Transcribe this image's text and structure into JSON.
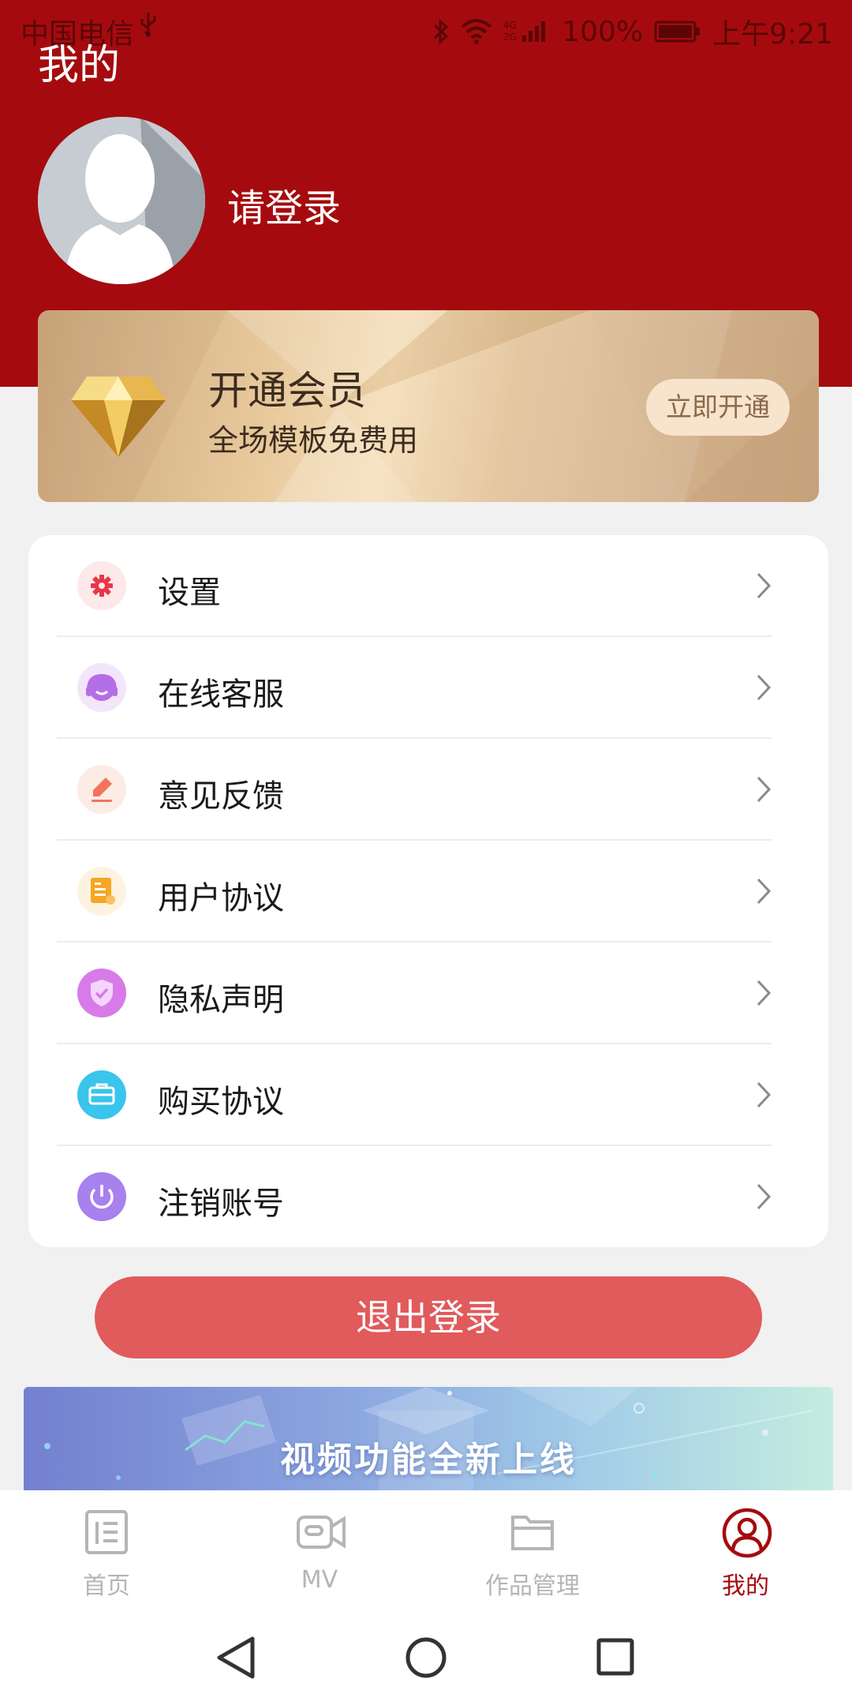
{
  "status_bar": {
    "carrier": "中国电信",
    "battery": "100%",
    "time": "上午9:21"
  },
  "header": {
    "title": "我的",
    "login_prompt": "请登录"
  },
  "vip": {
    "title": "开通会员",
    "subtitle": "全场模板免费用",
    "button": "立即开通"
  },
  "menu": [
    {
      "label": "设置",
      "icon": "gear-icon",
      "color": "#e8374a"
    },
    {
      "label": "在线客服",
      "icon": "headset-icon",
      "color": "#b46ee6"
    },
    {
      "label": "意见反馈",
      "icon": "feedback-pen-icon",
      "color": "#f2745c"
    },
    {
      "label": "用户协议",
      "icon": "document-icon",
      "color": "#f6a623"
    },
    {
      "label": "隐私声明",
      "icon": "shield-icon",
      "color": "#d77be8"
    },
    {
      "label": "购买协议",
      "icon": "briefcase-icon",
      "color": "#39c5ec"
    },
    {
      "label": "注销账号",
      "icon": "power-icon",
      "color": "#a781ee"
    }
  ],
  "logout_button": "退出登录",
  "promo_banner": "视频功能全新上线",
  "tabs": [
    {
      "label": "首页",
      "icon": "home-list-icon",
      "active": false
    },
    {
      "label": "MV",
      "icon": "video-camera-icon",
      "active": false
    },
    {
      "label": "作品管理",
      "icon": "folder-icon",
      "active": false
    },
    {
      "label": "我的",
      "icon": "profile-icon",
      "active": true
    }
  ],
  "colors": {
    "brand_red": "#a50b0e",
    "logout_red": "#e15a5c",
    "vip_gold": "#e8c99c"
  }
}
